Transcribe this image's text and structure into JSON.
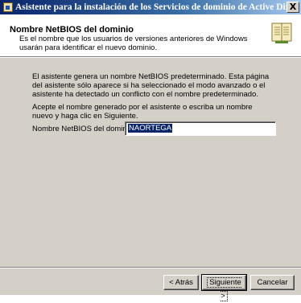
{
  "window": {
    "title": "Asistente para la instalación de los Servicios de dominio de Active Directory",
    "close_label": "X"
  },
  "header": {
    "title": "Nombre NetBIOS del dominio",
    "description": "Es el nombre que los usuarios de versiones anteriores de Windows usarán para identificar el nuevo dominio.",
    "icon": "book-icon"
  },
  "content": {
    "paragraph1": "El asistente genera un nombre NetBIOS predeterminado. Esta página del asistente sólo aparece si ha seleccionado el modo avanzado o el asistente ha detectado un conflicto con el nombre predeterminado.",
    "paragraph2": "Acepte el nombre generado por el asistente o escriba un nombre nuevo y haga clic en Siguiente.",
    "netbios_label": "Nombre NetBIOS del dominio:",
    "netbios_value": "NAORTEGA"
  },
  "buttons": {
    "back": "< Atrás",
    "next": "Siguiente >",
    "cancel": "Cancelar"
  },
  "colors": {
    "titlebar_start": "#0a246a",
    "titlebar_end": "#a6caf0",
    "dialog_face": "#d4d0c8",
    "selection": "#0a246a"
  }
}
